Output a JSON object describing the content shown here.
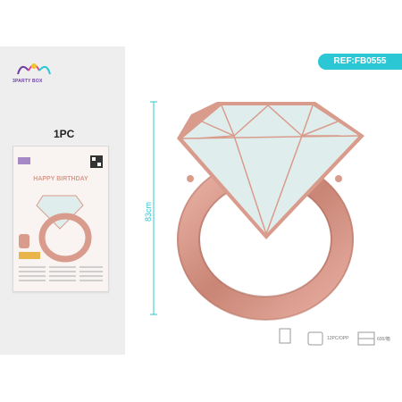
{
  "brand": {
    "logo_text": "3PARTY BOX"
  },
  "product": {
    "quantity_label": "1PC",
    "ref_label": "REF:FB0555",
    "dimension_label": "83cm"
  },
  "package": {
    "banner_text": "HAPPY BIRTHDAY"
  },
  "packing": {
    "size_label": "",
    "pack_label": "12PC/OPP",
    "carton_label": "600/箱"
  },
  "colors": {
    "accent": "#2cc7d4",
    "rose_gold": "#d99b8c",
    "diamond": "#dfeeed"
  }
}
